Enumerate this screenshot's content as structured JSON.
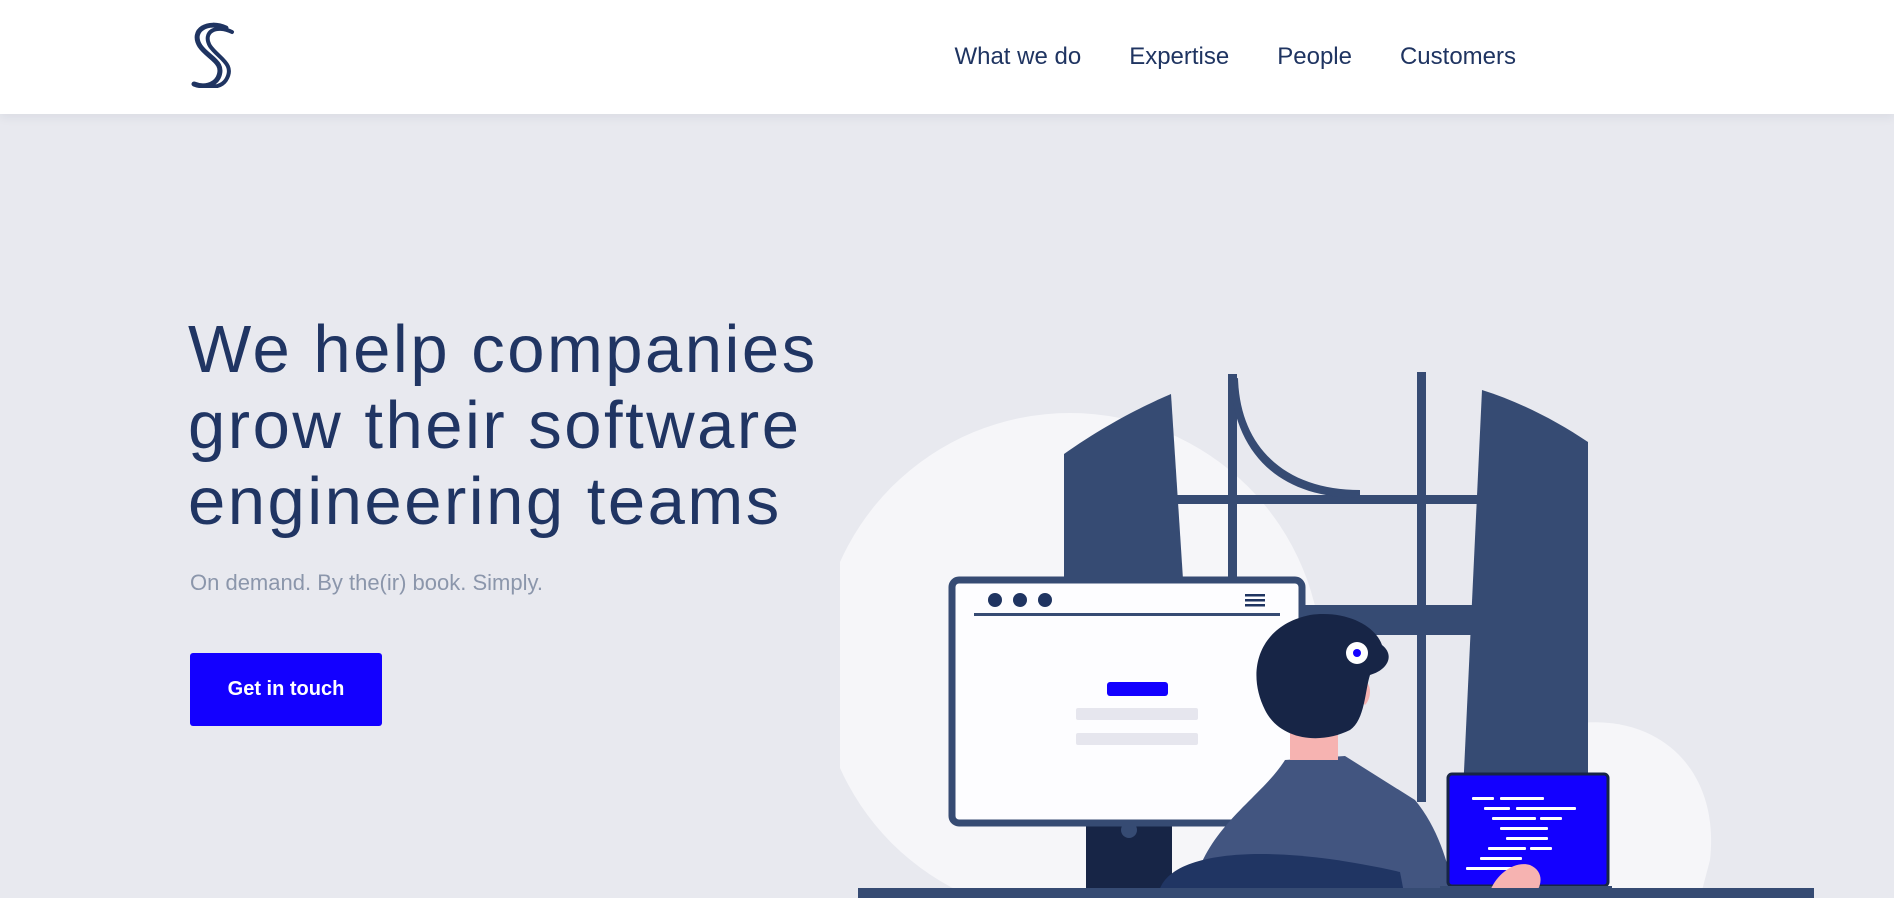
{
  "header": {
    "logo_icon": "s-logo-icon",
    "nav": [
      {
        "label": "What we do"
      },
      {
        "label": "Expertise"
      },
      {
        "label": "People"
      },
      {
        "label": "Customers"
      }
    ]
  },
  "hero": {
    "title_lines": [
      "We help companies",
      "grow their software",
      "engineering teams"
    ],
    "tagline": "On demand. By the(ir) book. Simply.",
    "cta_label": "Get in touch"
  },
  "colors": {
    "brand": "#1300ff",
    "navy": "#1f3461",
    "background": "#e8e9ef",
    "tagline": "#8b96ab"
  },
  "illustration": {
    "icon": "woman-at-computer-illustration"
  }
}
